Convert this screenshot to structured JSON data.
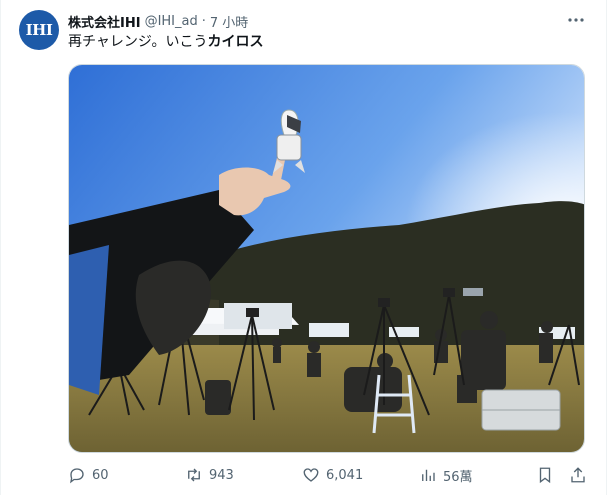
{
  "author": {
    "avatar_text": "IHI",
    "name": "株式会社IHI",
    "handle": "@IHI_ad",
    "separator": "·",
    "time": "7 小時"
  },
  "tweet": {
    "text_part1": "再チャレンジ。いこう",
    "text_bold": "カイロス"
  },
  "media": {
    "alt": "Hand holding a small rocket figurine against a blue sky above spectators with cameras and tripods on a grass field"
  },
  "actions": {
    "replies": "60",
    "retweets": "943",
    "likes": "6,041",
    "views": "56萬"
  },
  "icons": [
    "more-icon",
    "reply-icon",
    "retweet-icon",
    "like-icon",
    "views-icon",
    "bookmark-icon",
    "share-icon"
  ],
  "colors": {
    "brand_blue": "#1d5aa8",
    "muted": "#536471"
  }
}
